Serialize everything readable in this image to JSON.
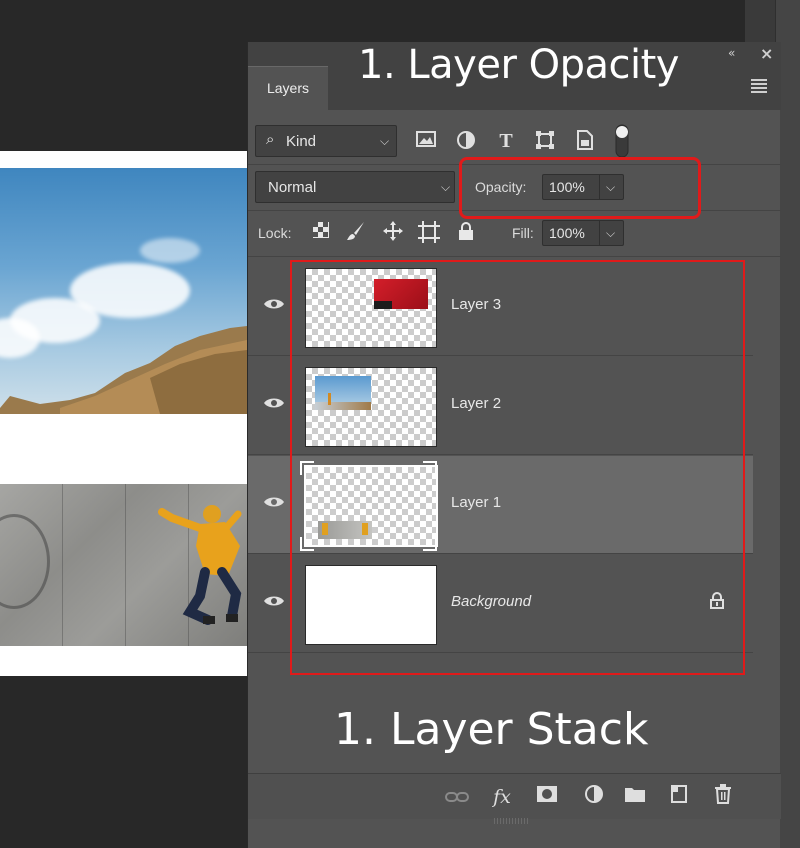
{
  "panel": {
    "tab_label": "Layers",
    "collapse_glyph": "«",
    "close_glyph": "×"
  },
  "annotations": {
    "top": "1. Layer Opacity",
    "bottom": "1. Layer Stack",
    "highlight_color": "#e01a1a"
  },
  "filter": {
    "kind_label": "Kind",
    "icons": [
      "image-filter-icon",
      "adjustment-filter-icon",
      "type-filter-icon",
      "shape-filter-icon",
      "smart-object-filter-icon",
      "filter-toggle-icon"
    ]
  },
  "blend": {
    "mode": "Normal",
    "opacity_label": "Opacity:",
    "opacity_value": "100%"
  },
  "lock": {
    "label": "Lock:",
    "icons": [
      "lock-transparent-pixels-icon",
      "lock-image-pixels-icon",
      "lock-position-icon",
      "lock-artboard-icon",
      "lock-all-icon"
    ],
    "fill_label": "Fill:",
    "fill_value": "100%"
  },
  "layers": [
    {
      "name": "Layer 3",
      "visible": true,
      "selected": false
    },
    {
      "name": "Layer 2",
      "visible": true,
      "selected": false
    },
    {
      "name": "Layer 1",
      "visible": true,
      "selected": true
    },
    {
      "name": "Background",
      "visible": true,
      "selected": false,
      "locked": true
    }
  ],
  "footer_icons": [
    "link-layers-icon",
    "fx-icon",
    "add-mask-icon",
    "new-fill-adjustment-icon",
    "new-group-icon",
    "new-layer-icon",
    "delete-layer-icon"
  ],
  "colors": {
    "panel_bg": "#535353",
    "selected_row": "#6a6a6a",
    "workspace": "#282828"
  }
}
